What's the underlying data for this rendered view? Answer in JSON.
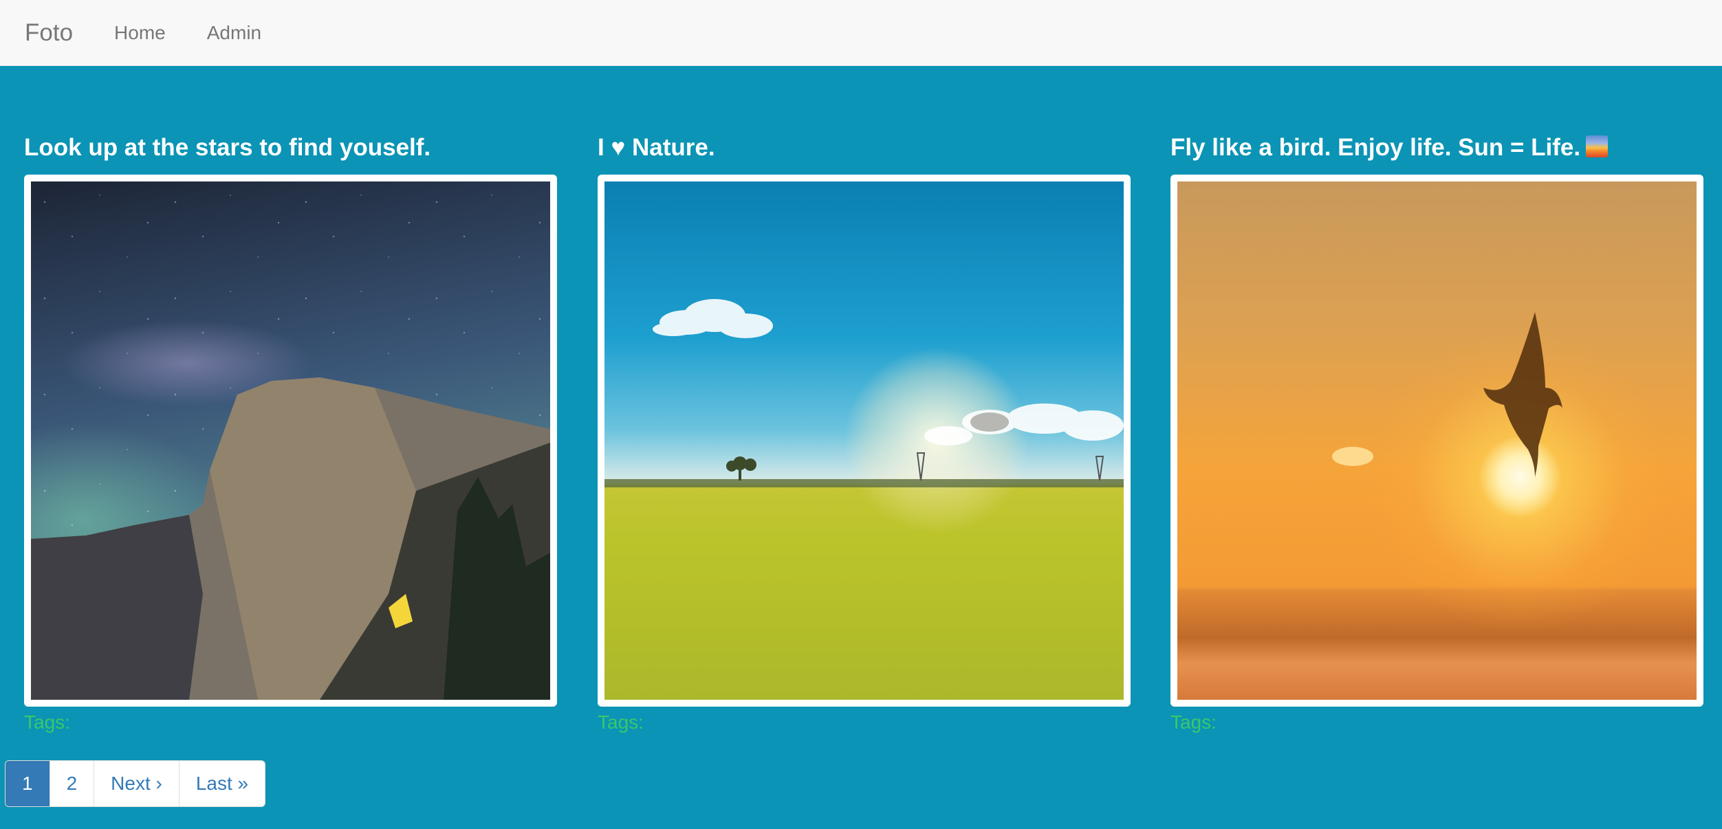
{
  "navbar": {
    "brand": "Foto",
    "links": [
      "Home",
      "Admin"
    ]
  },
  "posts": [
    {
      "title": "Look up at the stars to find youself.",
      "tags_label": "Tags:"
    },
    {
      "title": "I ♥ Nature.",
      "tags_label": "Tags:"
    },
    {
      "title": "Fly like a bird. Enjoy life. Sun = Life.",
      "emoji": "sunrise-emoji",
      "tags_label": "Tags:"
    }
  ],
  "pagination": {
    "items": [
      "1",
      "2",
      "Next ›",
      "Last »"
    ],
    "active": "1"
  },
  "colors": {
    "background": "#0b94b5",
    "navbar": "#f8f8f8",
    "link": "#337ab7",
    "tags": "#39c86a"
  }
}
